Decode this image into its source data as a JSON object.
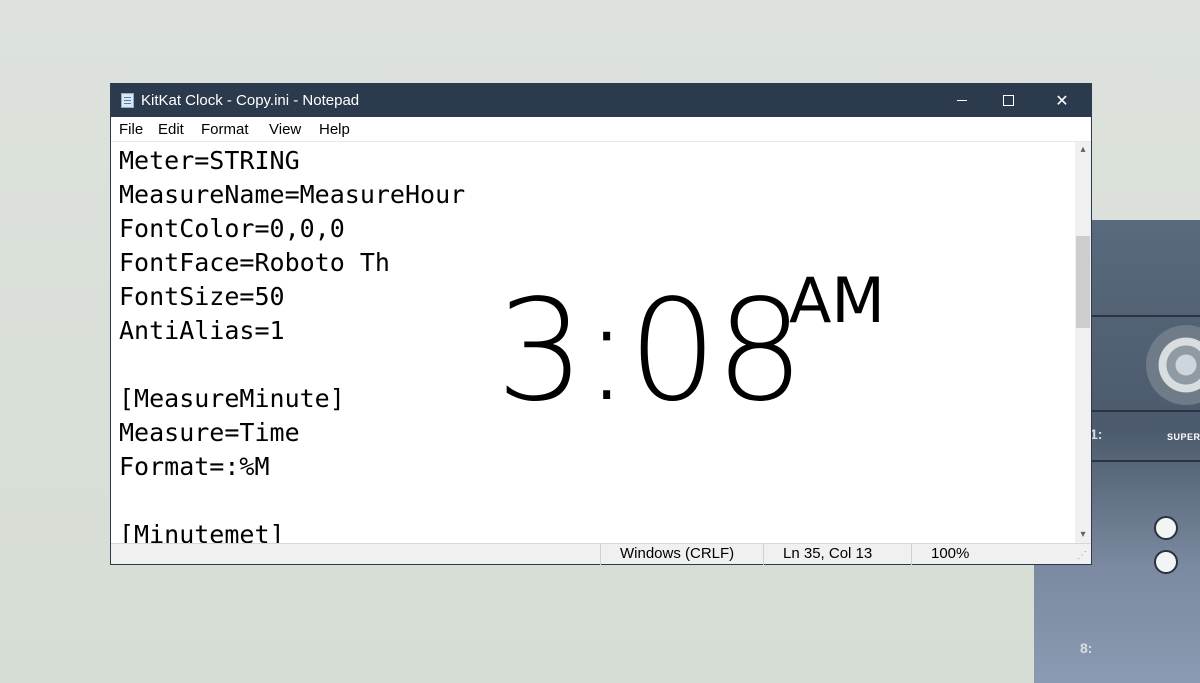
{
  "window": {
    "title": "KitKat Clock - Copy.ini - Notepad",
    "icon": "notepad-icon",
    "controls": {
      "minimize": "minimize-icon",
      "maximize": "maximize-icon",
      "close_glyph": "✕"
    }
  },
  "menu": [
    {
      "label": "File"
    },
    {
      "label": "Edit"
    },
    {
      "label": "Format"
    },
    {
      "label": "View"
    },
    {
      "label": "Help"
    }
  ],
  "editor": {
    "lines": [
      "Meter=STRING",
      "MeasureName=MeasureHour",
      "FontColor=0,0,0",
      "FontFace=Roboto Th",
      "FontSize=50",
      "AntiAlias=1",
      "",
      "[MeasureMinute]",
      "Measure=Time",
      "Format=:%M",
      "",
      "[Minutemet]"
    ]
  },
  "clock_widget": {
    "time": "3:08",
    "ampm": "AM"
  },
  "scrollbar": {
    "up_glyph": "▴",
    "down_glyph": "▾"
  },
  "statusbar": {
    "line_ending": "Windows (CRLF)",
    "position": "Ln 35, Col 13",
    "zoom": "100%"
  },
  "desktop": {
    "cassette_label": "SUPER",
    "cassette_glyph_1": "1:",
    "cassette_glyph_2": "8:"
  },
  "colors": {
    "titlebar": "#2b3b4d",
    "background": "#dde3dc",
    "statusbar": "#f0f0f0"
  }
}
